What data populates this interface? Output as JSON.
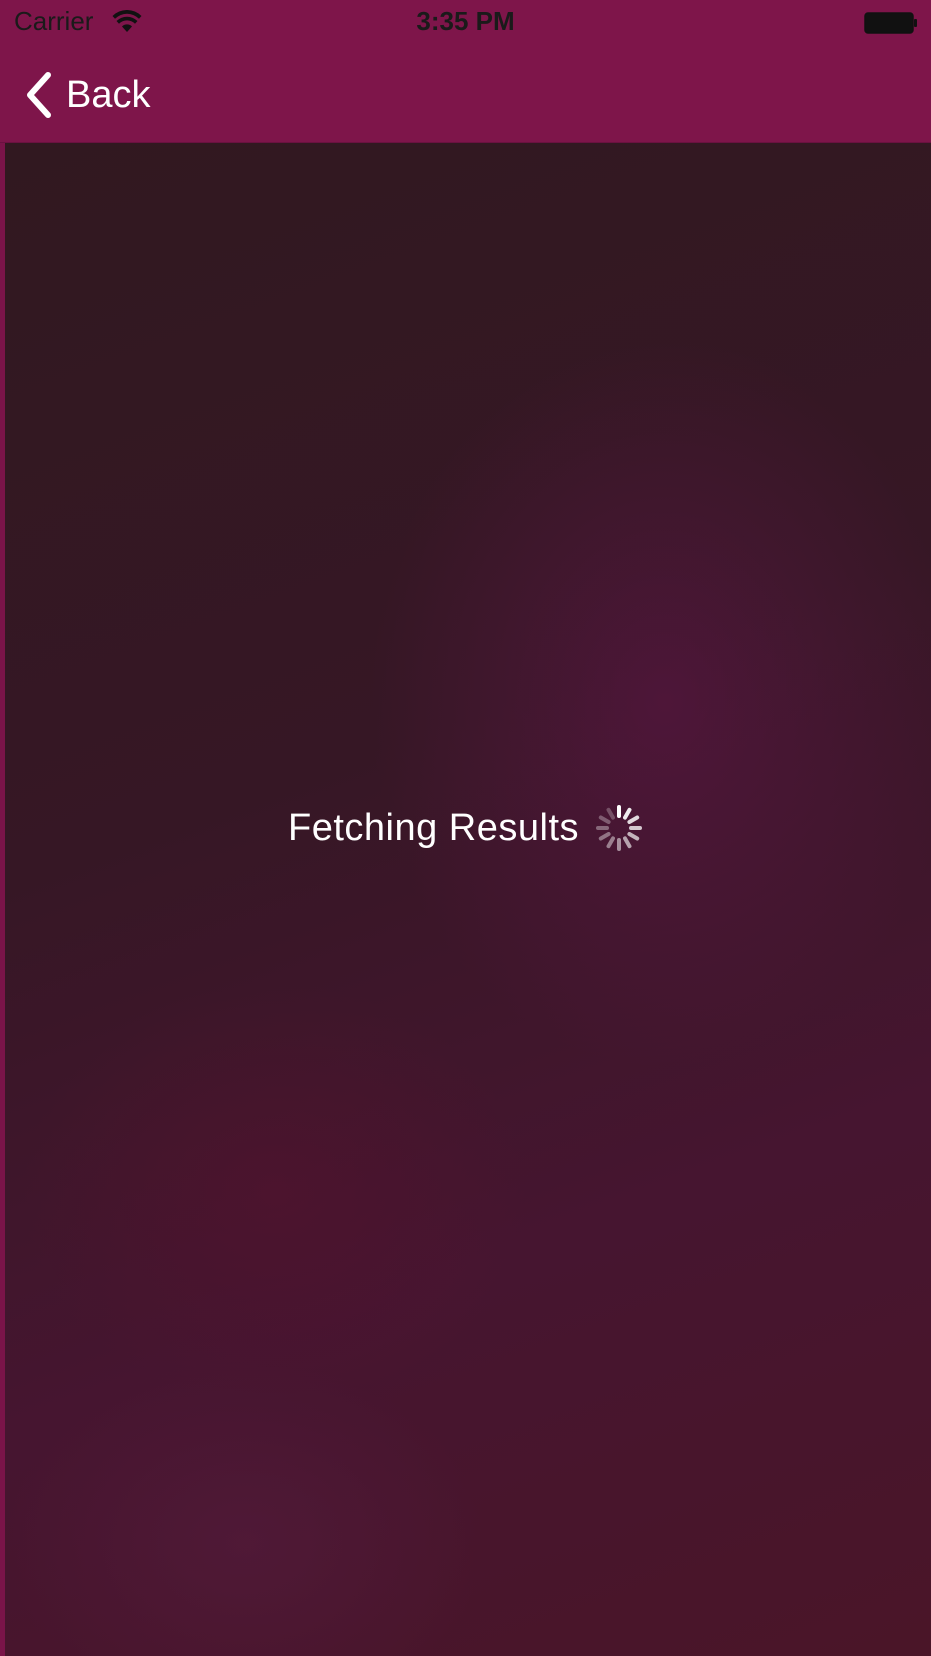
{
  "status_bar": {
    "carrier": "Carrier",
    "time": "3:35 PM"
  },
  "nav": {
    "back_label": "Back"
  },
  "content": {
    "loading_text": "Fetching Results"
  },
  "colors": {
    "bar": "#7e154a",
    "background_dark": "#311820",
    "text": "#ffffff"
  },
  "icons": {
    "wifi": "wifi-icon",
    "battery": "battery-icon",
    "back": "chevron-left-icon",
    "loading": "spinner-icon"
  }
}
